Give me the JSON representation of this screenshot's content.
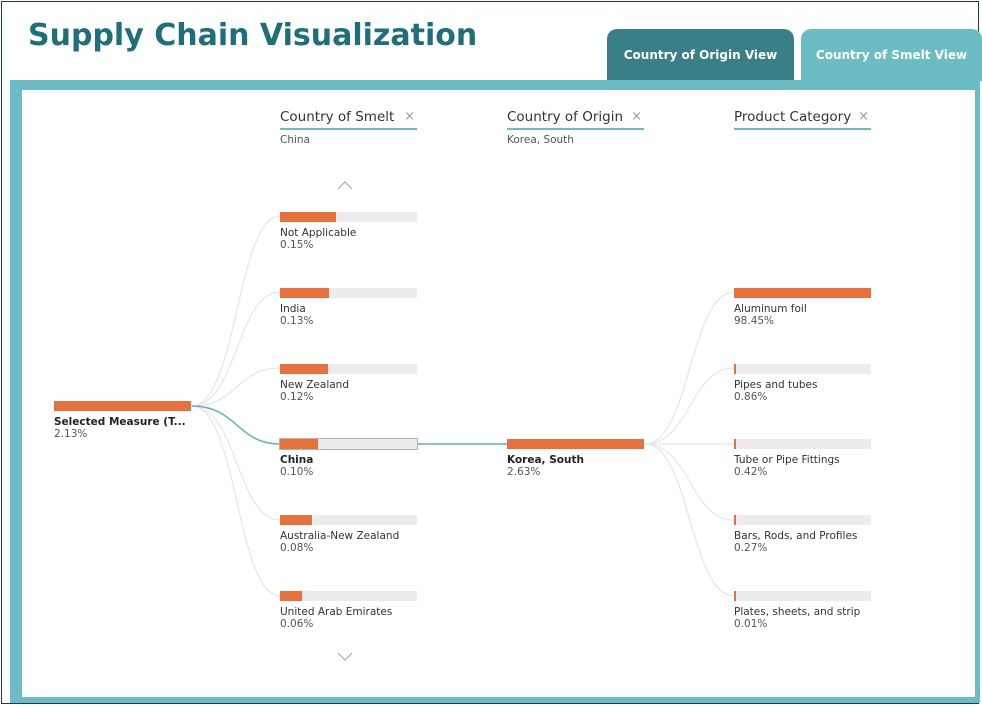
{
  "title": "Supply Chain Visualization",
  "tabs": [
    {
      "label": "Country of Origin View"
    },
    {
      "label": "Country of Smelt View"
    }
  ],
  "levels": [
    {
      "title": "Country of Smelt",
      "selected": "China",
      "close_icon": "×"
    },
    {
      "title": "Country of Origin",
      "selected": "Korea, South",
      "close_icon": "×"
    },
    {
      "title": "Product Category",
      "close_icon": "×"
    }
  ],
  "root": {
    "label": "Selected Measure (T...",
    "value": "2.13%"
  },
  "smelt_nodes": [
    {
      "label": "Not Applicable",
      "value": "0.15%",
      "fill": 0.41
    },
    {
      "label": "India",
      "value": "0.13%",
      "fill": 0.36
    },
    {
      "label": "New Zealand",
      "value": "0.12%",
      "fill": 0.35
    },
    {
      "label": "China",
      "value": "0.10%",
      "fill": 0.28
    },
    {
      "label": "Australia-New Zealand",
      "value": "0.08%",
      "fill": 0.23
    },
    {
      "label": "United Arab Emirates",
      "value": "0.06%",
      "fill": 0.16
    }
  ],
  "origin_nodes": [
    {
      "label": "Korea, South",
      "value": "2.63%",
      "fill": 1.0
    }
  ],
  "category_nodes": [
    {
      "label": "Aluminum foil",
      "value": "98.45%",
      "fill": 1.0
    },
    {
      "label": "Pipes and tubes",
      "value": "0.86%",
      "fill": 0.01
    },
    {
      "label": "Tube or Pipe Fittings",
      "value": "0.42%",
      "fill": 0.005
    },
    {
      "label": "Bars, Rods, and Profiles",
      "value": "0.27%",
      "fill": 0.003
    },
    {
      "label": "Plates, sheets, and strip",
      "value": "0.01%",
      "fill": 0.001
    }
  ],
  "scroll": {
    "up_icon": "chevron-up-icon",
    "down_icon": "chevron-down-icon"
  },
  "colors": {
    "accent": "#e8703a",
    "teal": "#6cbcc4",
    "dark_teal": "#3a7f86",
    "title": "#1d6f7a"
  }
}
